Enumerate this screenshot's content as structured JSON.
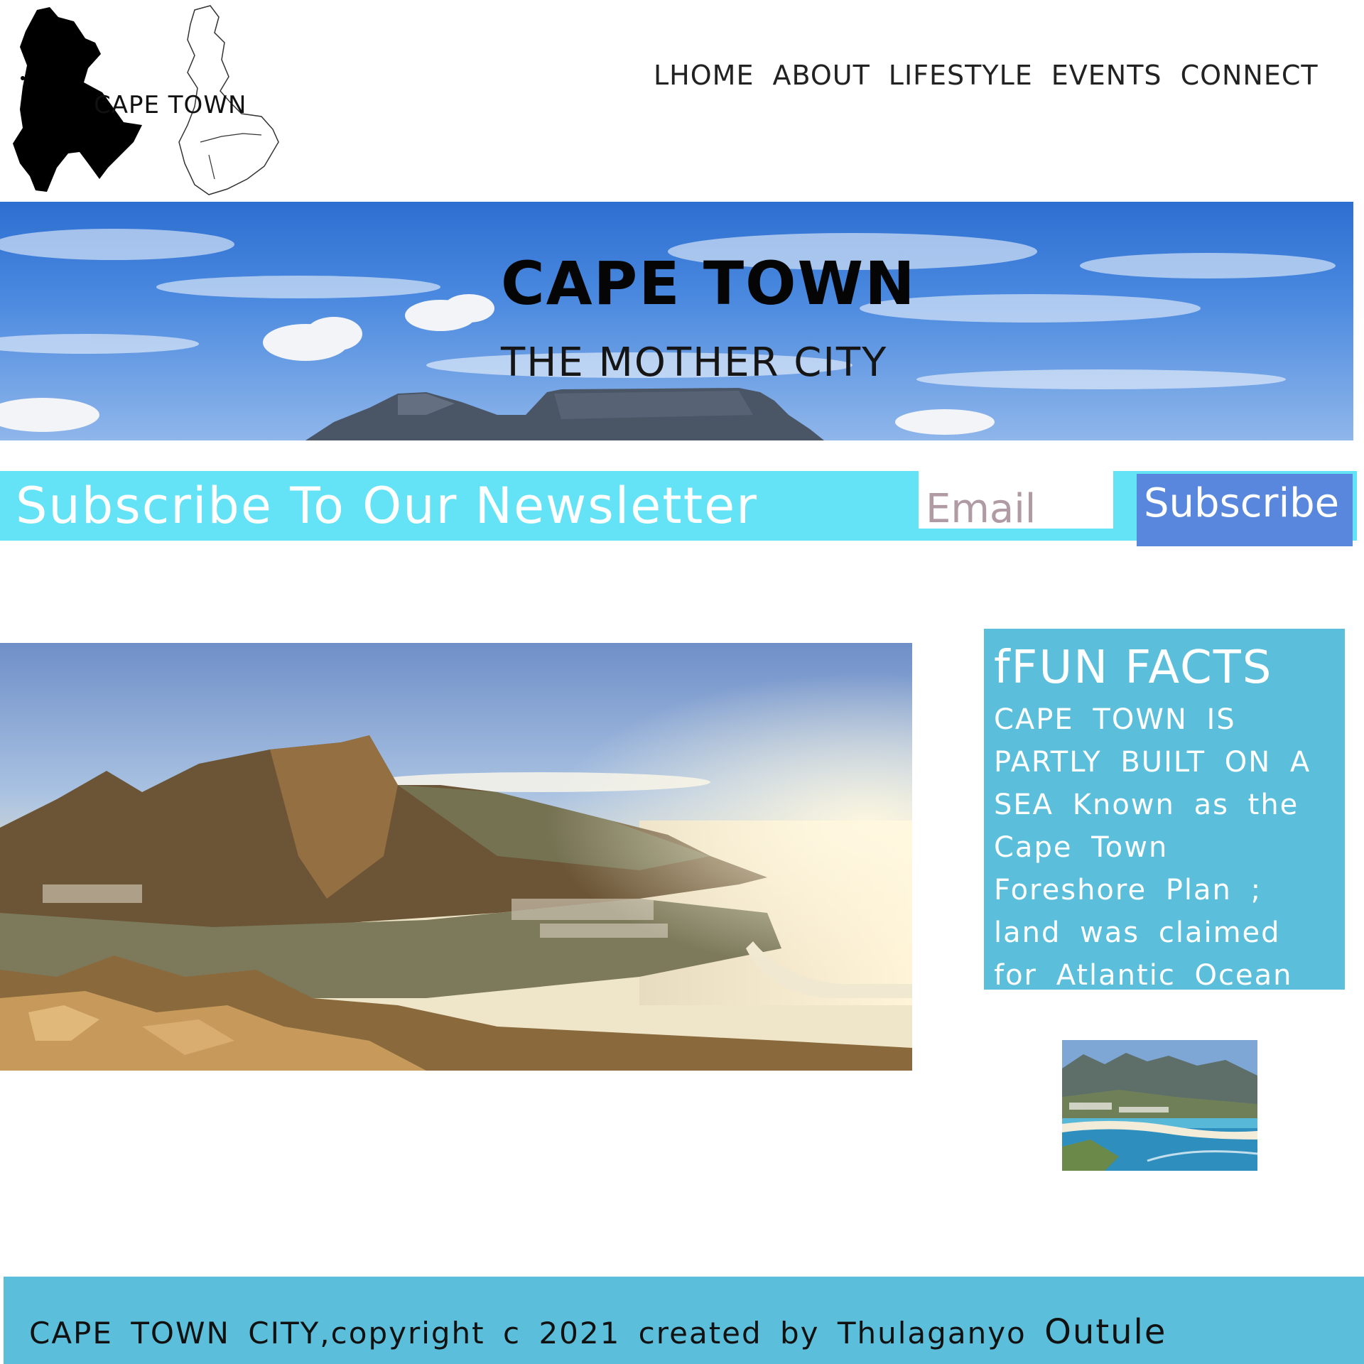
{
  "logo": {
    "text": "CAPE TOWN"
  },
  "nav": {
    "items": [
      {
        "label": "LHOME"
      },
      {
        "label": "ABOUT"
      },
      {
        "label": "LIFESTYLE"
      },
      {
        "label": "EVENTS"
      },
      {
        "label": "CONNECT"
      }
    ]
  },
  "hero": {
    "title": "CAPE TOWN",
    "subtitle": "THE MOTHER CITY"
  },
  "newsletter": {
    "heading": "Subscribe To Our Newsletter",
    "email_placeholder": "Email",
    "button_label": "Subscribe"
  },
  "facts": {
    "title": "fFUN FACTS",
    "body": "CAPE TOWN IS PARTLY BUILT ON A SEA Known as the Cape Town Foreshore Plan ; land was claimed for Atlantic Ocean"
  },
  "footer": {
    "text": "CAPE TOWN CITY,copyright c 2021 created by Thulaganyo",
    "name": "Outule"
  },
  "colors": {
    "newsletter_bar": "#63e3f5",
    "subscribe_button": "#5a87de",
    "facts_box": "#5bbfdb",
    "footer": "#5bbfdb"
  }
}
